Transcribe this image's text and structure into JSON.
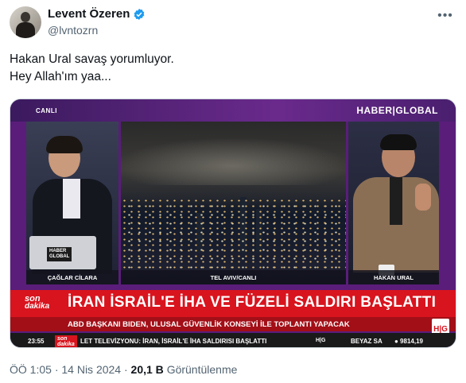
{
  "author": {
    "name": "Levent Özeren",
    "handle": "@lvntozrn",
    "verified": true,
    "avatar_icon": "avatar-photo",
    "more_icon": "more-options-icon"
  },
  "tweet": {
    "line1": "Hakan Ural savaş yorumluyor.",
    "line2": "Hey Allah'ım yaa..."
  },
  "video": {
    "live_label": "CANLI",
    "channel_logo": "HABER|GLOBAL",
    "left_caption": "ÇAĞLAR CİLARA",
    "mid_caption": "TEL AVIV/CANLI",
    "right_caption": "HAKAN URAL",
    "laptop_logo_1": "HABER",
    "laptop_logo_2": "GLOBAL",
    "sondakika_1": "son",
    "sondakika_2": "dakika",
    "headline": "İRAN İSRAİL'E İHA VE FÜZELİ SALDIRI BAŞLATTI",
    "subline": "ABD BAŞKANI BIDEN, ULUSAL GÜVENLİK KONSEYİ İLE TOPLANTI YAPACAK",
    "hg_badge": "H|G",
    "ticker_time": "23:55",
    "ticker_sd_1": "son",
    "ticker_sd_2": "dakika",
    "ticker_text": "LET TELEVİZYONU: İRAN, İSRAİL'E İHA SALDIRISI BAŞLATTI",
    "ticker_hg": "H|G",
    "ticker_weather": "BEYAZ SA",
    "ticker_market": "● 9814,19"
  },
  "meta": {
    "time": "ÖÖ 1:05",
    "separator": "·",
    "date": "14 Nis 2024",
    "views_count": "20,1 B",
    "views_label": "Görüntülenme"
  },
  "colors": {
    "verified": "#1d9bf0",
    "text_primary": "#0f1419",
    "text_secondary": "#536471",
    "news_red": "#d8141e",
    "channel_purple": "#5a1d7a"
  }
}
